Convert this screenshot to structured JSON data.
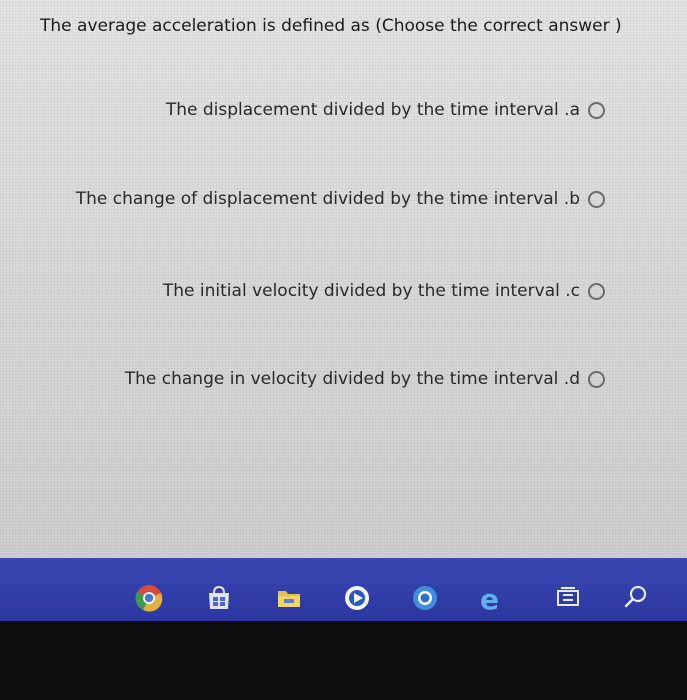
{
  "question": {
    "text": "The average acceleration is defined as (Choose the correct answer )"
  },
  "options": [
    {
      "text": "The displacement divided by the time interval .a",
      "selected": false
    },
    {
      "text": "The change of displacement divided by the time interval .b",
      "selected": false
    },
    {
      "text": "The initial velocity divided by the time interval .c",
      "selected": false
    },
    {
      "text": "The change in velocity divided by the time interval .d",
      "selected": false
    }
  ],
  "taskbar": {
    "icons": [
      "chrome-icon",
      "store-icon",
      "file-explorer-icon",
      "media-icon",
      "browser-icon",
      "edge-icon",
      "task-view-icon",
      "search-icon"
    ],
    "colors": {
      "background": "#2f3aa6"
    }
  }
}
